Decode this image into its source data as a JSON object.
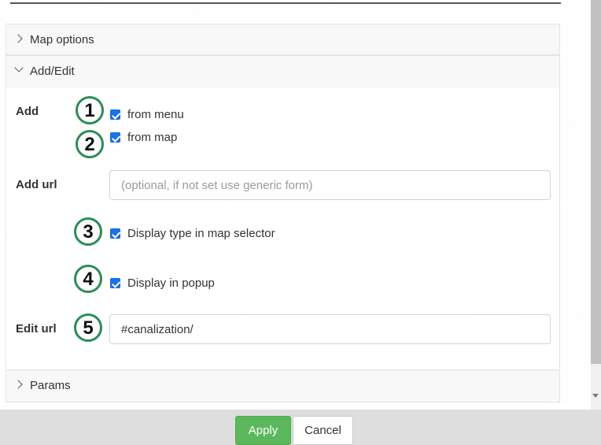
{
  "sections": {
    "map_options": {
      "label": "Map options"
    },
    "add_edit": {
      "label": "Add/Edit"
    },
    "params": {
      "label": "Params"
    }
  },
  "add_edit": {
    "add_label": "Add",
    "from_menu": {
      "label": "from menu",
      "checked": true
    },
    "from_map": {
      "label": "from map",
      "checked": true
    },
    "add_url": {
      "label": "Add url",
      "value": "",
      "placeholder": "(optional, if not set use generic form)"
    },
    "display_type": {
      "label": "Display type in map selector",
      "checked": true
    },
    "display_popup": {
      "label": "Display in popup",
      "checked": true
    },
    "edit_url": {
      "label": "Edit url",
      "value": "#canalization/"
    }
  },
  "markers": [
    "1",
    "2",
    "3",
    "4",
    "5"
  ],
  "footer": {
    "apply_label": "Apply",
    "cancel_label": "Cancel"
  },
  "colors": {
    "accent": "#5cb85c",
    "checkbox": "#1a73e8",
    "marker_ring": "#2e8b57"
  }
}
